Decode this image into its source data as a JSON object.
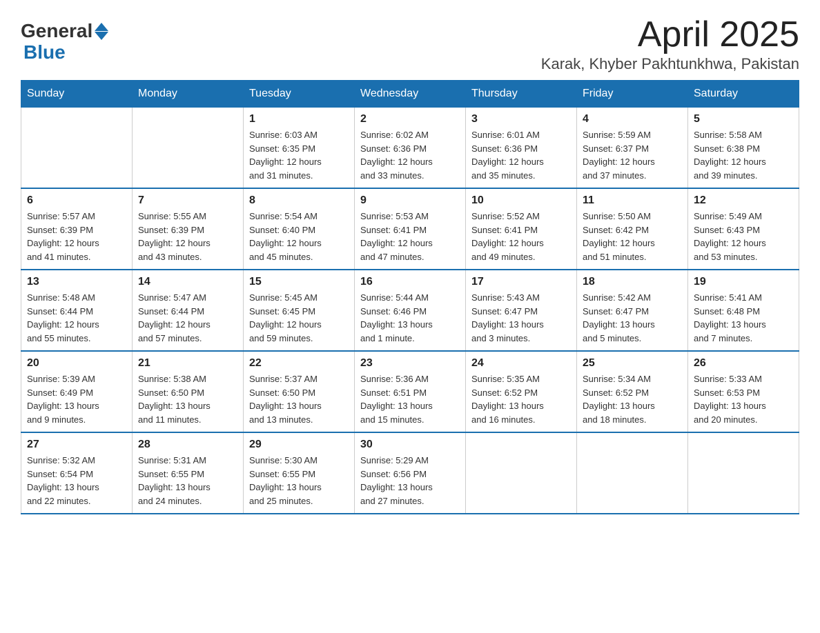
{
  "header": {
    "logo": {
      "text_general": "General",
      "text_blue": "Blue",
      "triangle": "▲"
    },
    "title": "April 2025",
    "subtitle": "Karak, Khyber Pakhtunkhwa, Pakistan"
  },
  "calendar": {
    "days_of_week": [
      "Sunday",
      "Monday",
      "Tuesday",
      "Wednesday",
      "Thursday",
      "Friday",
      "Saturday"
    ],
    "weeks": [
      [
        {
          "day": "",
          "info": ""
        },
        {
          "day": "",
          "info": ""
        },
        {
          "day": "1",
          "info": "Sunrise: 6:03 AM\nSunset: 6:35 PM\nDaylight: 12 hours\nand 31 minutes."
        },
        {
          "day": "2",
          "info": "Sunrise: 6:02 AM\nSunset: 6:36 PM\nDaylight: 12 hours\nand 33 minutes."
        },
        {
          "day": "3",
          "info": "Sunrise: 6:01 AM\nSunset: 6:36 PM\nDaylight: 12 hours\nand 35 minutes."
        },
        {
          "day": "4",
          "info": "Sunrise: 5:59 AM\nSunset: 6:37 PM\nDaylight: 12 hours\nand 37 minutes."
        },
        {
          "day": "5",
          "info": "Sunrise: 5:58 AM\nSunset: 6:38 PM\nDaylight: 12 hours\nand 39 minutes."
        }
      ],
      [
        {
          "day": "6",
          "info": "Sunrise: 5:57 AM\nSunset: 6:39 PM\nDaylight: 12 hours\nand 41 minutes."
        },
        {
          "day": "7",
          "info": "Sunrise: 5:55 AM\nSunset: 6:39 PM\nDaylight: 12 hours\nand 43 minutes."
        },
        {
          "day": "8",
          "info": "Sunrise: 5:54 AM\nSunset: 6:40 PM\nDaylight: 12 hours\nand 45 minutes."
        },
        {
          "day": "9",
          "info": "Sunrise: 5:53 AM\nSunset: 6:41 PM\nDaylight: 12 hours\nand 47 minutes."
        },
        {
          "day": "10",
          "info": "Sunrise: 5:52 AM\nSunset: 6:41 PM\nDaylight: 12 hours\nand 49 minutes."
        },
        {
          "day": "11",
          "info": "Sunrise: 5:50 AM\nSunset: 6:42 PM\nDaylight: 12 hours\nand 51 minutes."
        },
        {
          "day": "12",
          "info": "Sunrise: 5:49 AM\nSunset: 6:43 PM\nDaylight: 12 hours\nand 53 minutes."
        }
      ],
      [
        {
          "day": "13",
          "info": "Sunrise: 5:48 AM\nSunset: 6:44 PM\nDaylight: 12 hours\nand 55 minutes."
        },
        {
          "day": "14",
          "info": "Sunrise: 5:47 AM\nSunset: 6:44 PM\nDaylight: 12 hours\nand 57 minutes."
        },
        {
          "day": "15",
          "info": "Sunrise: 5:45 AM\nSunset: 6:45 PM\nDaylight: 12 hours\nand 59 minutes."
        },
        {
          "day": "16",
          "info": "Sunrise: 5:44 AM\nSunset: 6:46 PM\nDaylight: 13 hours\nand 1 minute."
        },
        {
          "day": "17",
          "info": "Sunrise: 5:43 AM\nSunset: 6:47 PM\nDaylight: 13 hours\nand 3 minutes."
        },
        {
          "day": "18",
          "info": "Sunrise: 5:42 AM\nSunset: 6:47 PM\nDaylight: 13 hours\nand 5 minutes."
        },
        {
          "day": "19",
          "info": "Sunrise: 5:41 AM\nSunset: 6:48 PM\nDaylight: 13 hours\nand 7 minutes."
        }
      ],
      [
        {
          "day": "20",
          "info": "Sunrise: 5:39 AM\nSunset: 6:49 PM\nDaylight: 13 hours\nand 9 minutes."
        },
        {
          "day": "21",
          "info": "Sunrise: 5:38 AM\nSunset: 6:50 PM\nDaylight: 13 hours\nand 11 minutes."
        },
        {
          "day": "22",
          "info": "Sunrise: 5:37 AM\nSunset: 6:50 PM\nDaylight: 13 hours\nand 13 minutes."
        },
        {
          "day": "23",
          "info": "Sunrise: 5:36 AM\nSunset: 6:51 PM\nDaylight: 13 hours\nand 15 minutes."
        },
        {
          "day": "24",
          "info": "Sunrise: 5:35 AM\nSunset: 6:52 PM\nDaylight: 13 hours\nand 16 minutes."
        },
        {
          "day": "25",
          "info": "Sunrise: 5:34 AM\nSunset: 6:52 PM\nDaylight: 13 hours\nand 18 minutes."
        },
        {
          "day": "26",
          "info": "Sunrise: 5:33 AM\nSunset: 6:53 PM\nDaylight: 13 hours\nand 20 minutes."
        }
      ],
      [
        {
          "day": "27",
          "info": "Sunrise: 5:32 AM\nSunset: 6:54 PM\nDaylight: 13 hours\nand 22 minutes."
        },
        {
          "day": "28",
          "info": "Sunrise: 5:31 AM\nSunset: 6:55 PM\nDaylight: 13 hours\nand 24 minutes."
        },
        {
          "day": "29",
          "info": "Sunrise: 5:30 AM\nSunset: 6:55 PM\nDaylight: 13 hours\nand 25 minutes."
        },
        {
          "day": "30",
          "info": "Sunrise: 5:29 AM\nSunset: 6:56 PM\nDaylight: 13 hours\nand 27 minutes."
        },
        {
          "day": "",
          "info": ""
        },
        {
          "day": "",
          "info": ""
        },
        {
          "day": "",
          "info": ""
        }
      ]
    ]
  }
}
